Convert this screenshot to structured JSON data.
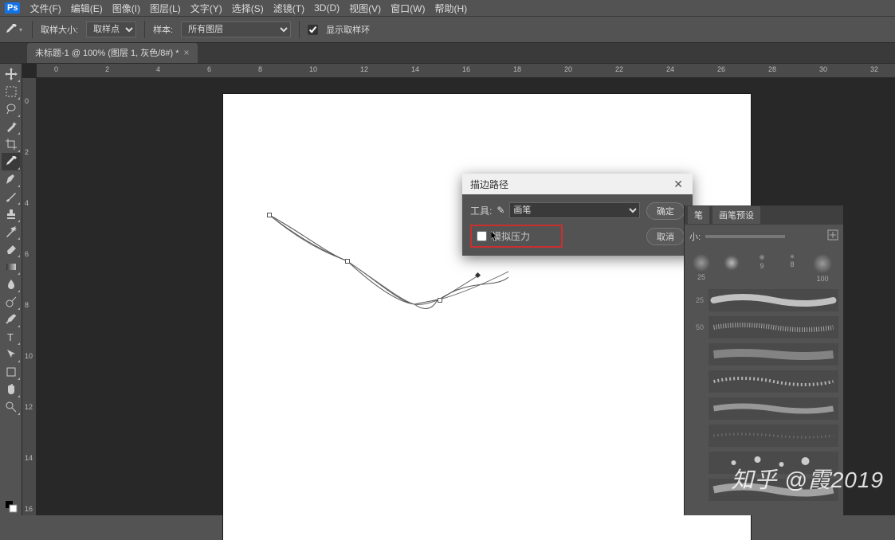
{
  "menu": {
    "ps": "Ps",
    "items": [
      "文件(F)",
      "编辑(E)",
      "图像(I)",
      "图层(L)",
      "文字(Y)",
      "选择(S)",
      "滤镜(T)",
      "3D(D)",
      "视图(V)",
      "窗口(W)",
      "帮助(H)"
    ]
  },
  "optbar": {
    "sample_size_label": "取样大小:",
    "sample_size_value": "取样点",
    "sample_label": "样本:",
    "sample_value": "所有图层",
    "show_ring_label": "显示取样环",
    "show_ring_checked": true
  },
  "tab": {
    "title": "未标题-1 @ 100% (图层 1, 灰色/8#) *"
  },
  "ruler": {
    "h": [
      "0",
      "2",
      "4",
      "6",
      "8",
      "10",
      "12",
      "14",
      "16",
      "18",
      "20",
      "22",
      "24",
      "26",
      "28",
      "30",
      "32"
    ],
    "v": [
      "0",
      "2",
      "4",
      "6",
      "8",
      "10",
      "12",
      "14",
      "16"
    ]
  },
  "tools": [
    "move",
    "marquee",
    "lasso",
    "wand",
    "crop",
    "eyedropper",
    "healing",
    "brush",
    "stamp",
    "history",
    "eraser",
    "gradient",
    "blur",
    "dodge",
    "pen",
    "type",
    "path-select",
    "rect-shape",
    "hand",
    "zoom"
  ],
  "dialog": {
    "title": "描边路径",
    "tool_label": "工具:",
    "tool_value": "画笔",
    "simulate_label": "模拟压力",
    "simulate_checked": false,
    "ok": "确定",
    "cancel": "取消"
  },
  "brushpanel": {
    "tabs": [
      "笔",
      "画笔预设"
    ],
    "size_label": "小:",
    "tips": [
      {
        "size": "25"
      },
      {
        "size": ""
      },
      {
        "size": ""
      },
      {
        "size": "9"
      },
      {
        "size": "8"
      },
      {
        "size": "100"
      }
    ],
    "strokes": [
      "25",
      "50",
      "",
      "",
      "",
      "",
      "",
      ""
    ]
  },
  "watermark": "知乎 @霞2019",
  "icons": {
    "brush_glyph": "✎",
    "chevron": "▾"
  }
}
